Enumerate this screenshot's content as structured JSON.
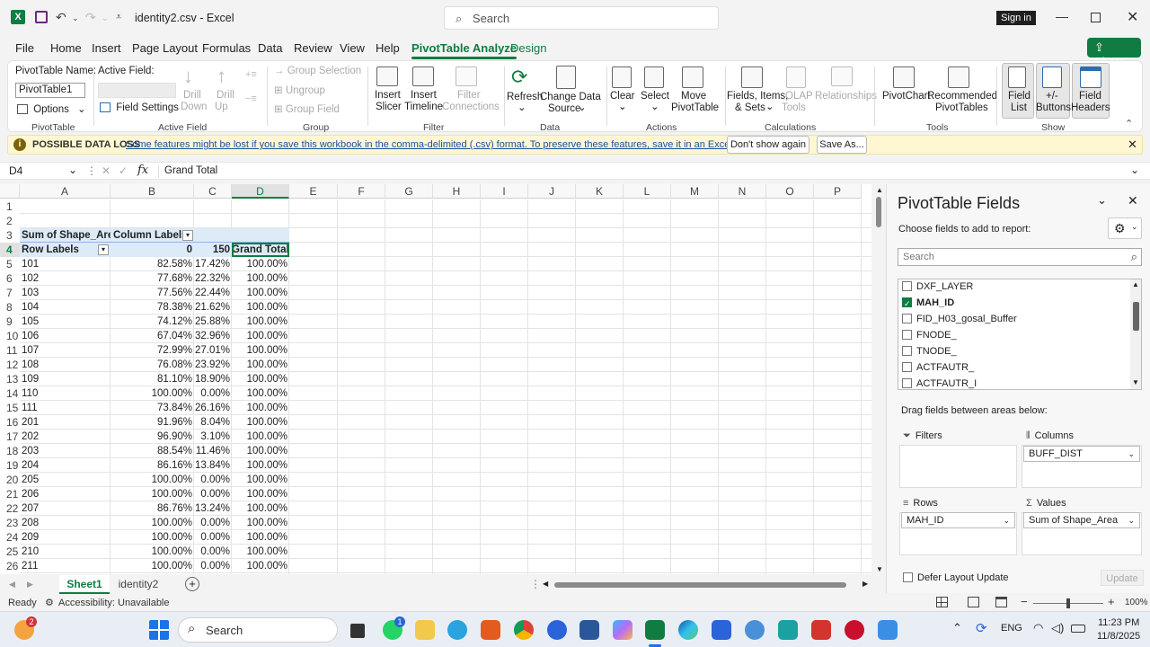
{
  "titlebar": {
    "filename": "identity2.csv",
    "separator": "-",
    "app": "Excel",
    "search_placeholder": "Search",
    "signin": "Sign in"
  },
  "menu": [
    "File",
    "Home",
    "Insert",
    "Page Layout",
    "Formulas",
    "Data",
    "Review",
    "View",
    "Help",
    "PivotTable Analyze",
    "Design"
  ],
  "share": "Share",
  "ribbon": {
    "pt_name_label": "PivotTable Name:",
    "pt_name_value": "PivotTable1",
    "options": "Options",
    "group_pivottable": "PivotTable",
    "active_field_label": "Active Field:",
    "field_settings": "Field Settings",
    "drill_down_1": "Drill",
    "drill_down_2": "Down",
    "drill_up_1": "Drill",
    "drill_up_2": "Up",
    "group_active_field": "Active Field",
    "group_selection": "Group Selection",
    "ungroup": "Ungroup",
    "group_field": "Group Field",
    "group_group": "Group",
    "insert_slicer_1": "Insert",
    "insert_slicer_2": "Slicer",
    "insert_timeline_1": "Insert",
    "insert_timeline_2": "Timeline",
    "filter_conn_1": "Filter",
    "filter_conn_2": "Connections",
    "group_filter": "Filter",
    "refresh": "Refresh",
    "change_source_1": "Change Data",
    "change_source_2": "Source",
    "group_data": "Data",
    "clear": "Clear",
    "select": "Select",
    "move_1": "Move",
    "move_2": "PivotTable",
    "group_actions": "Actions",
    "fields_items_1": "Fields, Items,",
    "fields_items_2": "& Sets",
    "olap_1": "OLAP",
    "olap_2": "Tools",
    "relationships": "Relationships",
    "group_calculations": "Calculations",
    "pivotchart": "PivotChart",
    "recommended_1": "Recommended",
    "recommended_2": "PivotTables",
    "group_tools": "Tools",
    "field_list_1": "Field",
    "field_list_2": "List",
    "buttons_1": "+/-",
    "buttons_2": "Buttons",
    "headers_1": "Field",
    "headers_2": "Headers",
    "group_show": "Show"
  },
  "infobar": {
    "title": "POSSIBLE DATA LOSS",
    "message": "Some features might be lost if you save this workbook in the comma-delimited (.csv) format. To preserve these features, save it in an Excel file format.",
    "dont_show": "Don't show again",
    "save_as": "Save As..."
  },
  "formula": {
    "namebox": "D4",
    "content": "Grand Total"
  },
  "columns": [
    "A",
    "B",
    "C",
    "D",
    "E",
    "F",
    "G",
    "H",
    "I",
    "J",
    "K",
    "L",
    "M",
    "N",
    "O",
    "P"
  ],
  "pivot": {
    "r3_a": "Sum of Shape_Area",
    "r3_b": "Column Labels",
    "r4_a": "Row Labels",
    "r4_b": "0",
    "r4_c": "150",
    "r4_d": "Grand Total",
    "rows": [
      [
        "5",
        "101",
        "82.58%",
        "17.42%",
        "100.00%"
      ],
      [
        "6",
        "102",
        "77.68%",
        "22.32%",
        "100.00%"
      ],
      [
        "7",
        "103",
        "77.56%",
        "22.44%",
        "100.00%"
      ],
      [
        "8",
        "104",
        "78.38%",
        "21.62%",
        "100.00%"
      ],
      [
        "9",
        "105",
        "74.12%",
        "25.88%",
        "100.00%"
      ],
      [
        "10",
        "106",
        "67.04%",
        "32.96%",
        "100.00%"
      ],
      [
        "11",
        "107",
        "72.99%",
        "27.01%",
        "100.00%"
      ],
      [
        "12",
        "108",
        "76.08%",
        "23.92%",
        "100.00%"
      ],
      [
        "13",
        "109",
        "81.10%",
        "18.90%",
        "100.00%"
      ],
      [
        "14",
        "110",
        "100.00%",
        "0.00%",
        "100.00%"
      ],
      [
        "15",
        "111",
        "73.84%",
        "26.16%",
        "100.00%"
      ],
      [
        "16",
        "201",
        "91.96%",
        "8.04%",
        "100.00%"
      ],
      [
        "17",
        "202",
        "96.90%",
        "3.10%",
        "100.00%"
      ],
      [
        "18",
        "203",
        "88.54%",
        "11.46%",
        "100.00%"
      ],
      [
        "19",
        "204",
        "86.16%",
        "13.84%",
        "100.00%"
      ],
      [
        "20",
        "205",
        "100.00%",
        "0.00%",
        "100.00%"
      ],
      [
        "21",
        "206",
        "100.00%",
        "0.00%",
        "100.00%"
      ],
      [
        "22",
        "207",
        "86.76%",
        "13.24%",
        "100.00%"
      ],
      [
        "23",
        "208",
        "100.00%",
        "0.00%",
        "100.00%"
      ],
      [
        "24",
        "209",
        "100.00%",
        "0.00%",
        "100.00%"
      ],
      [
        "25",
        "210",
        "100.00%",
        "0.00%",
        "100.00%"
      ],
      [
        "26",
        "211",
        "100.00%",
        "0.00%",
        "100.00%"
      ]
    ]
  },
  "pane": {
    "title": "PivotTable Fields",
    "choose": "Choose fields to add to report:",
    "search_placeholder": "Search",
    "fields": [
      {
        "name": "DXF_LAYER",
        "checked": false
      },
      {
        "name": "MAH_ID",
        "checked": true
      },
      {
        "name": "FID_H03_gosal_Buffer",
        "checked": false
      },
      {
        "name": "FNODE_",
        "checked": false
      },
      {
        "name": "TNODE_",
        "checked": false
      },
      {
        "name": "ACTFAUTR_",
        "checked": false
      },
      {
        "name": "ACTFAUTR_I",
        "checked": false
      }
    ],
    "drag_label": "Drag fields between areas below:",
    "filters": "Filters",
    "columns": "Columns",
    "columns_item": "BUFF_DIST",
    "rows": "Rows",
    "rows_item": "MAH_ID",
    "values": "Values",
    "values_item": "Sum of Shape_Area",
    "defer": "Defer Layout Update",
    "update": "Update"
  },
  "sheets": {
    "active": "Sheet1",
    "other": "identity2"
  },
  "status": {
    "ready": "Ready",
    "accessibility": "Accessibility: Unavailable",
    "zoom": "100%"
  },
  "taskbar": {
    "search": "Search",
    "lang": "ENG",
    "time": "11:23 PM",
    "date": "11/8/2025",
    "weather_badge": "2",
    "whatsapp_badge": "1"
  }
}
